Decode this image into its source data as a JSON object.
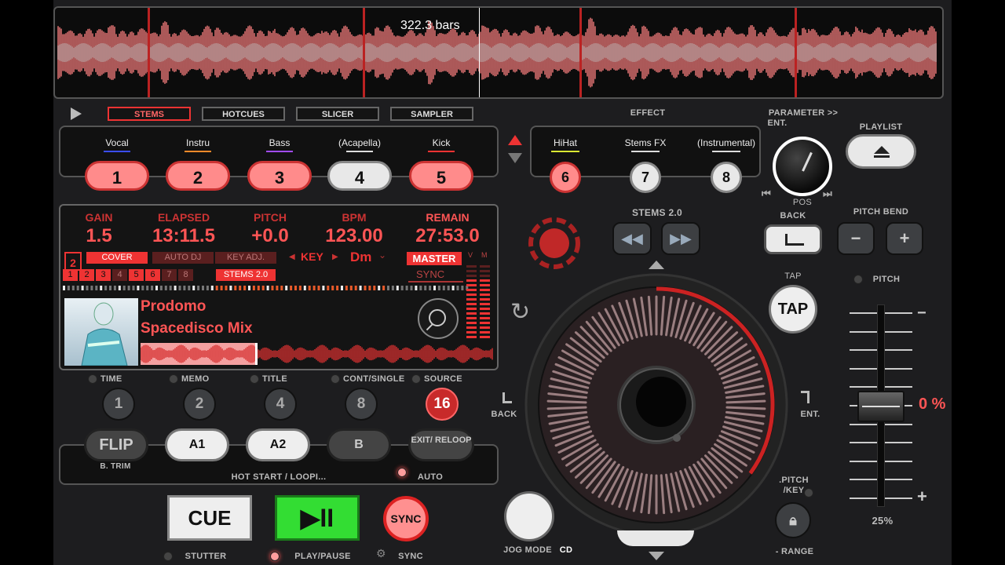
{
  "waveform": {
    "bars_label": "322.3 bars"
  },
  "tabs": [
    {
      "label": "STEMS",
      "active": true
    },
    {
      "label": "HOTCUES",
      "active": false
    },
    {
      "label": "SLICER",
      "active": false
    },
    {
      "label": "SAMPLER",
      "active": false
    }
  ],
  "effect_label": "EFFECT",
  "parameter_label": "PARAMETER >>",
  "ent_label": "ENT.",
  "pos_label": "POS",
  "playlist": {
    "label": "PLAYLIST"
  },
  "stems": [
    {
      "name": "Vocal",
      "num": "1",
      "color": "#3a4dff",
      "style": "red"
    },
    {
      "name": "Instru",
      "num": "2",
      "color": "#ff8a2a",
      "style": "red"
    },
    {
      "name": "Bass",
      "num": "3",
      "color": "#a24cff",
      "style": "red"
    },
    {
      "name": "(Acapella)",
      "num": "4",
      "color": "#dddddd",
      "style": "white"
    },
    {
      "name": "Kick",
      "num": "5",
      "color": "#ff3333",
      "style": "red"
    }
  ],
  "fx_stems": [
    {
      "name": "HiHat",
      "num": "6",
      "color": "#d9e832"
    },
    {
      "name": "Stems FX",
      "num": "7",
      "color": "#dddddd"
    },
    {
      "name": "(Instrumental)",
      "num": "8",
      "color": "#dddddd"
    }
  ],
  "lcd": {
    "gain": {
      "label": "GAIN",
      "value": "1.5"
    },
    "elapsed": {
      "label": "ELAPSED",
      "value": "13:11.5"
    },
    "pitch": {
      "label": "PITCH",
      "value": "+0.0"
    },
    "bpm": {
      "label": "BPM",
      "value": "123.00"
    },
    "remain": {
      "label": "REMAIN",
      "value": "27:53.0"
    },
    "deck_number": "2",
    "cover": "COVER",
    "auto_dj": "AUTO DJ",
    "key_adj": "KEY ADJ.",
    "key_label": "KEY",
    "key_value": "Dm",
    "master": "MASTER",
    "stems20": "STEMS 2.0",
    "sync": "SYNC",
    "vu_v": "V",
    "vu_m": "M",
    "stem_cells": [
      "1",
      "2",
      "3",
      "4",
      "5",
      "6",
      "7",
      "8"
    ],
    "artist": "Prodomo",
    "title": "Spacedisco Mix"
  },
  "stems20_label": "STEMS 2.0",
  "back_label": "BACK",
  "pitch_bend_label": "PITCH BEND",
  "tap": {
    "top_label": "TAP",
    "button": "TAP"
  },
  "pitch": {
    "label": "PITCH",
    "value": "0 %",
    "range": "25%",
    "minus": "−",
    "plus": "+"
  },
  "display_modes": [
    {
      "label": "TIME",
      "num": "1"
    },
    {
      "label": "MEMO",
      "num": "2"
    },
    {
      "label": "TITLE",
      "num": "4"
    },
    {
      "label": "CONT/SINGLE",
      "num": "8"
    },
    {
      "label": "SOURCE",
      "num": "16"
    }
  ],
  "loop": {
    "flip": "FLIP",
    "b_trim": "B. TRIM",
    "a1": "A1",
    "a2": "A2",
    "b": "B",
    "exit_reloop": "EXIT/ RELOOP",
    "hot_start": "HOT START / LOOPI...",
    "auto": "AUTO"
  },
  "transport": {
    "cue": "CUE",
    "play_pause_symbol": "▶II",
    "sync": "SYNC",
    "stutter": "STUTTER",
    "play_pause": "PLAY/PAUSE",
    "sync_label": "SYNC"
  },
  "jog": {
    "mode_label": "JOG MODE",
    "mode_value": "CD",
    "back": "BACK",
    "ent": "ENT."
  },
  "pitch_key": {
    "label": ".PITCH /KEY",
    "range": "- RANGE"
  },
  "colors": {
    "accent": "#ff4444",
    "play_green": "#33dd33",
    "panel_border": "#555555"
  }
}
